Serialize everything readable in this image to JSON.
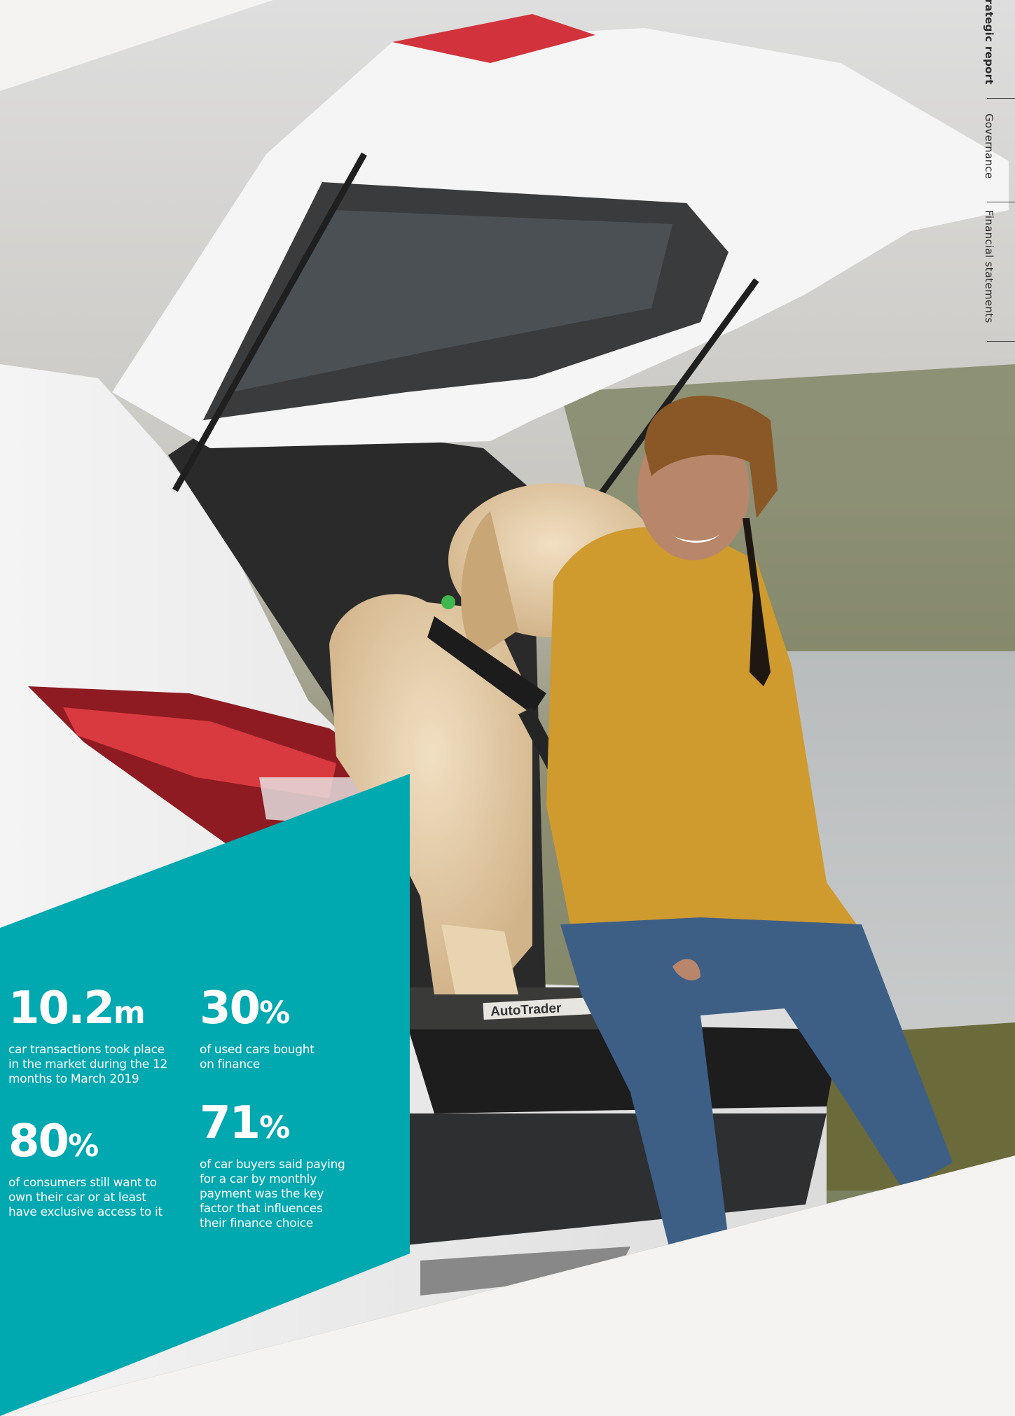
{
  "nav": {
    "tabs": [
      {
        "label": "Strategic report",
        "active": true
      },
      {
        "label": "Governance",
        "active": false
      },
      {
        "label": "Financial statements",
        "active": false
      }
    ]
  },
  "stats": [
    {
      "value": "10.2",
      "unit": "m",
      "desc": "car transactions took place in the market during the 12 months to March 2019"
    },
    {
      "value": "30",
      "unit": "%",
      "desc": "of used cars bought on finance"
    },
    {
      "value": "80",
      "unit": "%",
      "desc": "of consumers still want to own their car or at least have exclusive access to it"
    },
    {
      "value": "71",
      "unit": "%",
      "desc": "of car buyers said paying for a car by monthly payment was the key factor that influences their finance choice"
    }
  ],
  "photo": {
    "subject": "woman and golden retriever sitting in open car boot",
    "brand_text": "AutoTrader"
  },
  "colors": {
    "accent": "#00a8b0",
    "background": "#f4f3f2"
  }
}
